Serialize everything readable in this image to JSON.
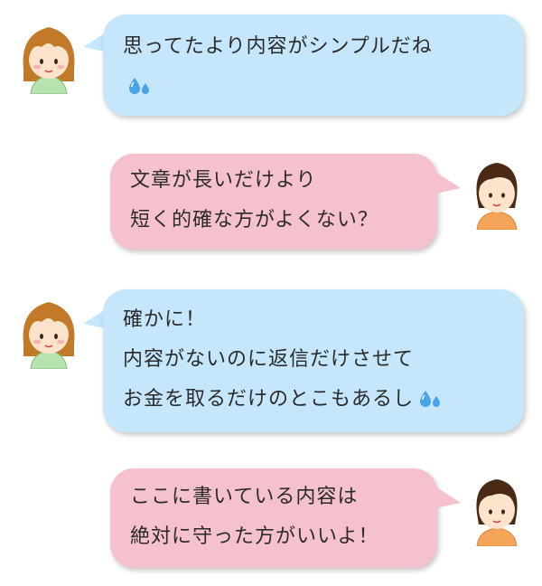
{
  "messages": [
    {
      "speaker": "girl",
      "color": "#c5e6fb",
      "lines": [
        "思ってたより内容がシンプルだね"
      ],
      "emoji": "sweat-drops-icon"
    },
    {
      "speaker": "woman",
      "color": "#f5c1cc",
      "lines": [
        "文章が長いだけより",
        "短く的確な方がよくない？"
      ]
    },
    {
      "speaker": "girl",
      "color": "#c5e6fb",
      "lines": [
        "確かに！",
        "内容がないのに返信だけさせて",
        "お金を取るだけのとこもあるし"
      ],
      "emoji": "sweat-drops-icon"
    },
    {
      "speaker": "woman",
      "color": "#f5c1cc",
      "lines": [
        "ここに書いている内容は",
        "絶対に守った方がいいよ！"
      ]
    }
  ]
}
